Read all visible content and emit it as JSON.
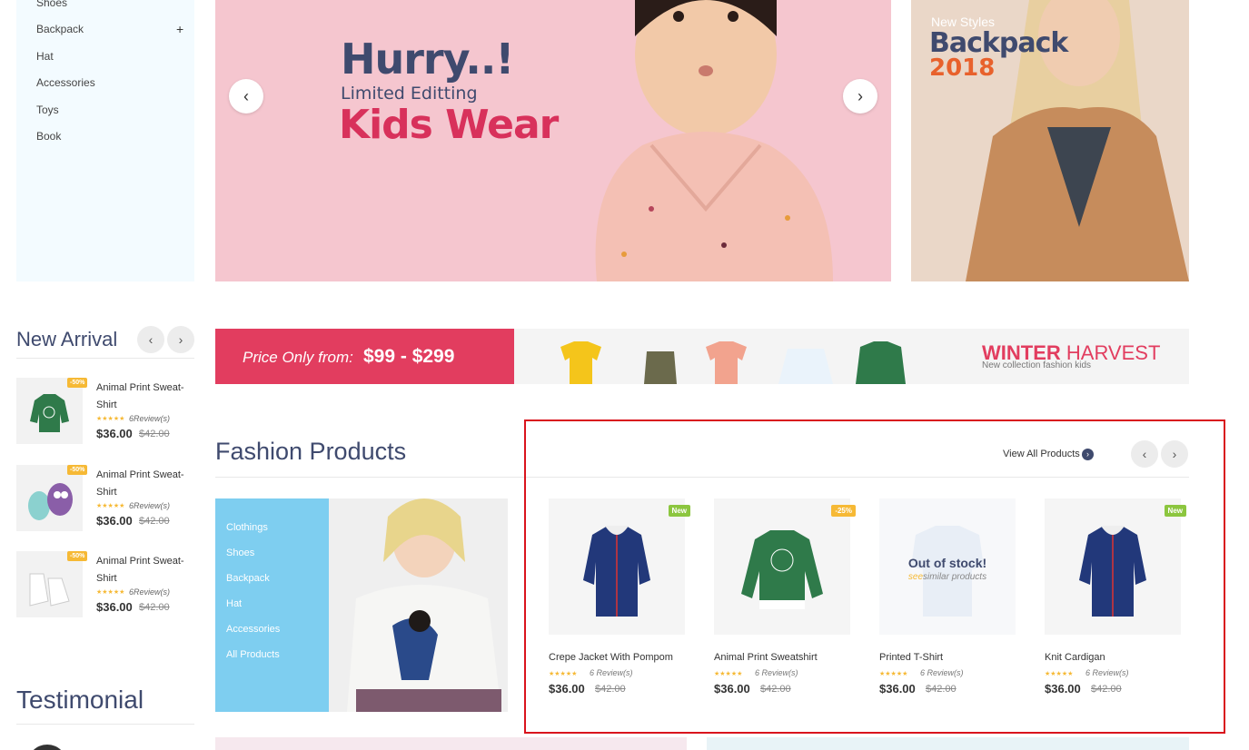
{
  "categories": [
    {
      "label": "Shoes",
      "expandable": false
    },
    {
      "label": "Backpack",
      "expandable": true
    },
    {
      "label": "Hat",
      "expandable": false
    },
    {
      "label": "Accessories",
      "expandable": false
    },
    {
      "label": "Toys",
      "expandable": false
    },
    {
      "label": "Book",
      "expandable": false
    }
  ],
  "hero": {
    "line1": "Hurry..!",
    "line2": "Limited Editting",
    "line3": "Kids Wear",
    "prev_icon": "chevron-left-icon",
    "next_icon": "chevron-right-icon"
  },
  "side_banner": {
    "line1": "New Styles",
    "line2": "Backpack",
    "line3": "2018"
  },
  "new_arrival": {
    "title": "New Arrival",
    "items": [
      {
        "badge": "-50%",
        "name": "Animal Print Sweat-Shirt",
        "stars": "★★★★★",
        "reviews": "6Review(s)",
        "price": "$36.00",
        "old_price": "$42.00"
      },
      {
        "badge": "-50%",
        "name": "Animal Print Sweat-Shirt",
        "stars": "★★★★★",
        "reviews": "6Review(s)",
        "price": "$36.00",
        "old_price": "$42.00"
      },
      {
        "badge": "-50%",
        "name": "Animal Print Sweat-Shirt",
        "stars": "★★★★★",
        "reviews": "6Review(s)",
        "price": "$36.00",
        "old_price": "$42.00"
      }
    ]
  },
  "promo": {
    "label": "Price Only from:",
    "price_range": "$99 - $299",
    "winter_bold": "WINTER",
    "winter_rest": " HARVEST",
    "subtitle": "New collection fashion kids"
  },
  "fashion": {
    "title": "Fashion Products",
    "view_all": "View All Products",
    "categories": [
      "Clothings",
      "Shoes",
      "Backpack",
      "Hat",
      "Accessories",
      "All Products"
    ],
    "products": [
      {
        "name": "Crepe Jacket With Pompom",
        "badge": "New",
        "badge_color": "#8cc63f",
        "stars": "★★★★★",
        "reviews": "6 Review(s)",
        "price": "$36.00",
        "old_price": "$42.00"
      },
      {
        "name": "Animal Print Sweatshirt",
        "badge": "-25%",
        "badge_color": "#f6b935",
        "stars": "★★★★★",
        "reviews": "6 Review(s)",
        "price": "$36.00",
        "old_price": "$42.00"
      },
      {
        "name": "Printed T-Shirt",
        "out_of_stock": "Out of stock!",
        "see": "see",
        "similar": "similar products",
        "stars": "★★★★★",
        "reviews": "6 Review(s)",
        "price": "$36.00",
        "old_price": "$42.00"
      },
      {
        "name": "Knit Cardigan",
        "badge": "New",
        "badge_color": "#8cc63f",
        "stars": "★★★★★",
        "reviews": "6 Review(s)",
        "price": "$36.00",
        "old_price": "$42.00"
      }
    ]
  },
  "testimonial": {
    "title": "Testimonial"
  }
}
